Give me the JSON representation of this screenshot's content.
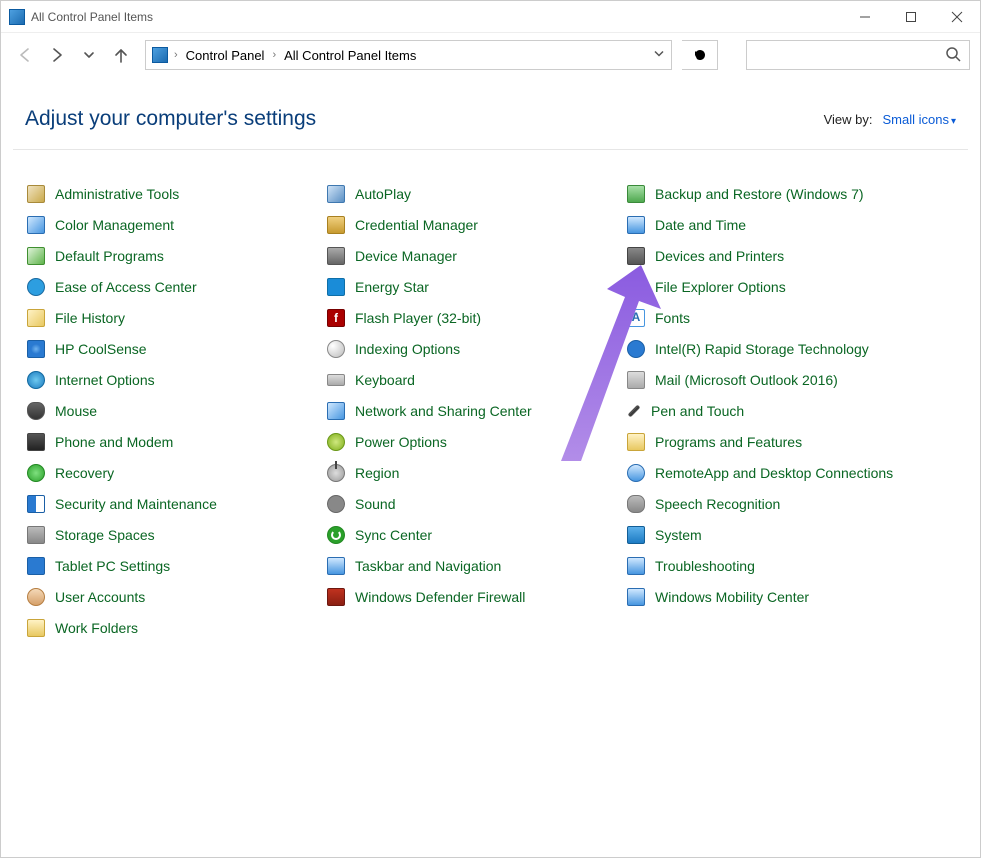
{
  "window": {
    "title": "All Control Panel Items"
  },
  "breadcrumb": {
    "crumb1": "Control Panel",
    "crumb2": "All Control Panel Items"
  },
  "header": {
    "title": "Adjust your computer's settings",
    "viewby_label": "View by:",
    "viewby_value": "Small icons"
  },
  "col1": [
    {
      "label": "Administrative Tools",
      "icon": "tools"
    },
    {
      "label": "Color Management",
      "icon": "color"
    },
    {
      "label": "Default Programs",
      "icon": "default"
    },
    {
      "label": "Ease of Access Center",
      "icon": "ease"
    },
    {
      "label": "File History",
      "icon": "hist"
    },
    {
      "label": "HP CoolSense",
      "icon": "hp"
    },
    {
      "label": "Internet Options",
      "icon": "globe"
    },
    {
      "label": "Mouse",
      "icon": "mouse"
    },
    {
      "label": "Phone and Modem",
      "icon": "phone"
    },
    {
      "label": "Recovery",
      "icon": "recov"
    },
    {
      "label": "Security and Maintenance",
      "icon": "flag"
    },
    {
      "label": "Storage Spaces",
      "icon": "storage"
    },
    {
      "label": "Tablet PC Settings",
      "icon": "tablet"
    },
    {
      "label": "User Accounts",
      "icon": "user"
    },
    {
      "label": "Work Folders",
      "icon": "folder"
    }
  ],
  "col2": [
    {
      "label": "AutoPlay",
      "icon": "autoplay"
    },
    {
      "label": "Credential Manager",
      "icon": "cred"
    },
    {
      "label": "Device Manager",
      "icon": "device"
    },
    {
      "label": "Energy Star",
      "icon": "energy"
    },
    {
      "label": "Flash Player (32-bit)",
      "icon": "flash"
    },
    {
      "label": "Indexing Options",
      "icon": "index"
    },
    {
      "label": "Keyboard",
      "icon": "keyboard"
    },
    {
      "label": "Network and Sharing Center",
      "icon": "network"
    },
    {
      "label": "Power Options",
      "icon": "power"
    },
    {
      "label": "Region",
      "icon": "region"
    },
    {
      "label": "Sound",
      "icon": "sound"
    },
    {
      "label": "Sync Center",
      "icon": "sync"
    },
    {
      "label": "Taskbar and Navigation",
      "icon": "taskbar"
    },
    {
      "label": "Windows Defender Firewall",
      "icon": "firewall"
    }
  ],
  "col3": [
    {
      "label": "Backup and Restore (Windows 7)",
      "icon": "backup"
    },
    {
      "label": "Date and Time",
      "icon": "date"
    },
    {
      "label": "Devices and Printers",
      "icon": "printer"
    },
    {
      "label": "File Explorer Options",
      "icon": "explorer"
    },
    {
      "label": "Fonts",
      "icon": "fonts"
    },
    {
      "label": "Intel(R) Rapid Storage Technology",
      "icon": "rapid"
    },
    {
      "label": "Mail (Microsoft Outlook 2016)",
      "icon": "mail"
    },
    {
      "label": "Pen and Touch",
      "icon": "pen"
    },
    {
      "label": "Programs and Features",
      "icon": "programs"
    },
    {
      "label": "RemoteApp and Desktop Connections",
      "icon": "remote"
    },
    {
      "label": "Speech Recognition",
      "icon": "speech"
    },
    {
      "label": "System",
      "icon": "system"
    },
    {
      "label": "Troubleshooting",
      "icon": "trouble"
    },
    {
      "label": "Windows Mobility Center",
      "icon": "mobility"
    }
  ]
}
